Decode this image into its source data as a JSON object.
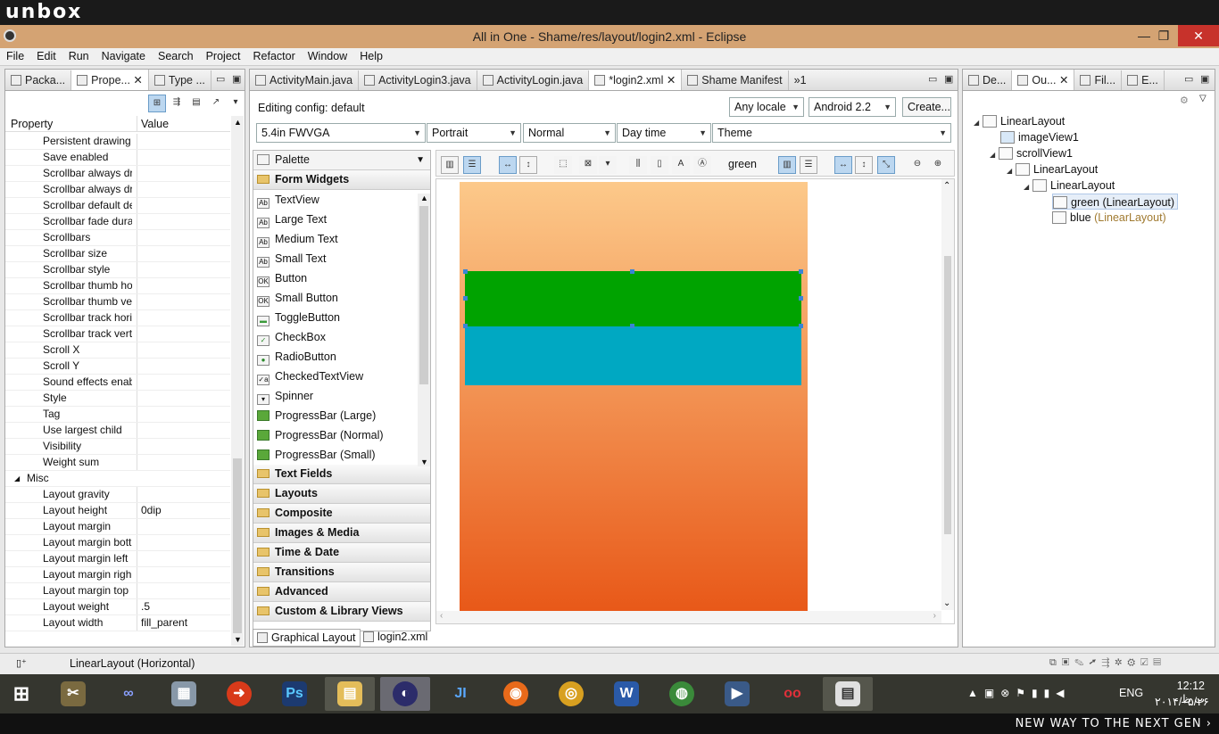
{
  "brand_top": "unbox",
  "brand_bottom": "NEW WAY TO THE NEXT GEN ›",
  "window": {
    "title": "All in One - Shame/res/layout/login2.xml - Eclipse",
    "min": "—",
    "max": "❐",
    "close": "✕"
  },
  "menu": [
    "File",
    "Edit",
    "Run",
    "Navigate",
    "Search",
    "Project",
    "Refactor",
    "Window",
    "Help"
  ],
  "left_tabs": [
    "Packa...",
    "Prope...",
    "Type ..."
  ],
  "properties": {
    "col_property": "Property",
    "col_value": "Value",
    "rows": [
      {
        "name": "Persistent drawing",
        "value": ""
      },
      {
        "name": "Save enabled",
        "value": ""
      },
      {
        "name": "Scrollbar always dra",
        "value": ""
      },
      {
        "name": "Scrollbar always dra",
        "value": ""
      },
      {
        "name": "Scrollbar default de",
        "value": ""
      },
      {
        "name": "Scrollbar fade dura",
        "value": ""
      },
      {
        "name": "Scrollbars",
        "value": ""
      },
      {
        "name": "Scrollbar size",
        "value": ""
      },
      {
        "name": "Scrollbar style",
        "value": ""
      },
      {
        "name": "Scrollbar thumb ho",
        "value": ""
      },
      {
        "name": "Scrollbar thumb ve",
        "value": ""
      },
      {
        "name": "Scrollbar track hori",
        "value": ""
      },
      {
        "name": "Scrollbar track verti",
        "value": ""
      },
      {
        "name": "Scroll X",
        "value": ""
      },
      {
        "name": "Scroll Y",
        "value": ""
      },
      {
        "name": "Sound effects enab",
        "value": ""
      },
      {
        "name": "Style",
        "value": ""
      },
      {
        "name": "Tag",
        "value": ""
      },
      {
        "name": "Use largest child",
        "value": ""
      },
      {
        "name": "Visibility",
        "value": ""
      },
      {
        "name": "Weight sum",
        "value": ""
      },
      {
        "name": "Misc",
        "value": "",
        "group": true
      },
      {
        "name": "Layout gravity",
        "value": ""
      },
      {
        "name": "Layout height",
        "value": "0dip"
      },
      {
        "name": "Layout margin",
        "value": ""
      },
      {
        "name": "Layout margin bott",
        "value": ""
      },
      {
        "name": "Layout margin left",
        "value": ""
      },
      {
        "name": "Layout margin righ",
        "value": ""
      },
      {
        "name": "Layout margin top",
        "value": ""
      },
      {
        "name": "Layout weight",
        "value": ".5"
      },
      {
        "name": "Layout width",
        "value": "fill_parent"
      }
    ]
  },
  "editor_tabs": [
    "ActivityMain.java",
    "ActivityLogin3.java",
    "ActivityLogin.java",
    "*login2.xml",
    "Shame Manifest",
    "»1"
  ],
  "config": {
    "label": "Editing config:",
    "value": "default",
    "locale": "Any locale",
    "android": "Android 2.2",
    "create": "Create...",
    "device": "5.4in FWVGA",
    "orientation": "Portrait",
    "mode": "Normal",
    "time": "Day time",
    "theme": "Theme"
  },
  "palette": {
    "title": "Palette",
    "open_folder": "Form Widgets",
    "items": [
      {
        "icon": "Ab",
        "label": "TextView"
      },
      {
        "icon": "Ab",
        "label": "Large Text"
      },
      {
        "icon": "Ab",
        "label": "Medium Text"
      },
      {
        "icon": "Ab",
        "label": "Small Text"
      },
      {
        "icon": "OK",
        "label": "Button"
      },
      {
        "icon": "OK",
        "label": "Small Button"
      },
      {
        "icon": "▬",
        "label": "ToggleButton"
      },
      {
        "icon": "✓",
        "label": "CheckBox"
      },
      {
        "icon": "●",
        "label": "RadioButton"
      },
      {
        "icon": "✓a",
        "label": "CheckedTextView"
      },
      {
        "icon": "▾",
        "label": "Spinner"
      },
      {
        "icon": "",
        "label": "ProgressBar (Large)"
      },
      {
        "icon": "",
        "label": "ProgressBar (Normal)"
      },
      {
        "icon": "",
        "label": "ProgressBar (Small)"
      }
    ],
    "folders": [
      "Text Fields",
      "Layouts",
      "Composite",
      "Images & Media",
      "Time & Date",
      "Transitions",
      "Advanced",
      "Custom & Library Views"
    ]
  },
  "canvas_toolbar": {
    "selected_label": "green"
  },
  "canvas_colors": {
    "green": "#00a300",
    "blue": "#00a8c2",
    "bg_top": "#fcc98a",
    "bg_bottom": "#e85818"
  },
  "bottom_tabs": [
    "Graphical Layout",
    "login2.xml"
  ],
  "right_tabs": [
    "De...",
    "Ou...",
    "Fil...",
    "E..."
  ],
  "outline": [
    {
      "label": "LinearLayout",
      "suffix": ""
    },
    {
      "label": "imageView1",
      "suffix": ""
    },
    {
      "label": "scrollView1",
      "suffix": ""
    },
    {
      "label": "LinearLayout",
      "suffix": ""
    },
    {
      "label": "LinearLayout",
      "suffix": ""
    },
    {
      "label": "green (LinearLayout)",
      "suffix": ""
    },
    {
      "label": "blue ",
      "suffix": "(LinearLayout)"
    }
  ],
  "status": {
    "text": "LinearLayout (Horizontal)"
  },
  "taskbar": {
    "lang": "ENG",
    "time": "12:12 ب.ظ",
    "date": "۲۰۱۴/۰۵/۲۶"
  }
}
